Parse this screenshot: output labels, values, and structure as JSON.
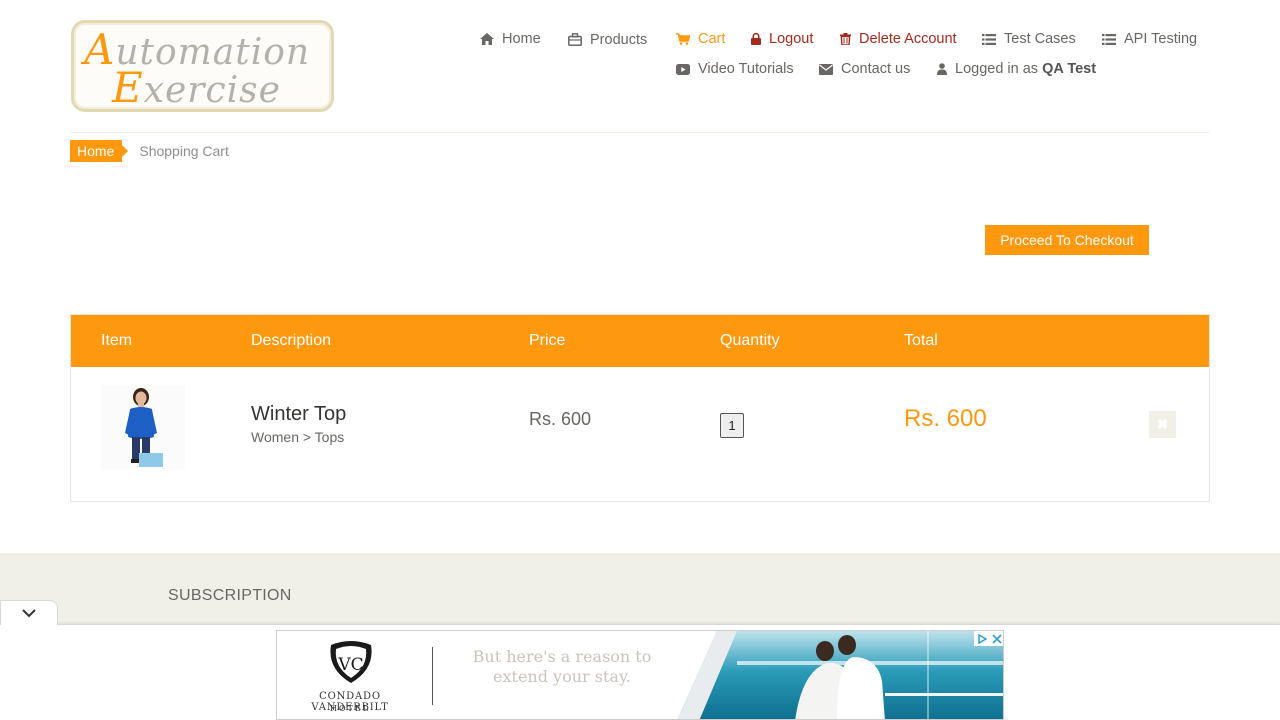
{
  "logo": {
    "line1_cap": "A",
    "line1_rest": "utomation",
    "line2_cap": "E",
    "line2_rest": "xercise"
  },
  "nav": {
    "home": "Home",
    "products": "Products",
    "cart": "Cart",
    "logout": "Logout",
    "delete_account": "Delete Account",
    "test_cases": "Test Cases",
    "api_testing": "API Testing",
    "video_tutorials": "Video Tutorials",
    "contact_us": "Contact us",
    "logged_in_prefix": "Logged in as",
    "logged_in_user": "QA Test"
  },
  "breadcrumb": {
    "home": "Home",
    "current": "Shopping Cart"
  },
  "checkout_button": "Proceed To Checkout",
  "cart": {
    "headers": {
      "item": "Item",
      "description": "Description",
      "price": "Price",
      "quantity": "Quantity",
      "total": "Total"
    },
    "rows": [
      {
        "name": "Winter Top",
        "category": "Women > Tops",
        "price": "Rs. 600",
        "quantity": "1",
        "total": "Rs. 600",
        "delete_icon": "close-icon"
      }
    ]
  },
  "footer": {
    "subscription_title": "SUBSCRIPTION"
  },
  "ad": {
    "brand_line1": "CONDADO VANDERBILT",
    "brand_line2": "HOTEL",
    "tagline": "But here's a reason to extend your stay."
  },
  "colors": {
    "accent": "#fe980f",
    "danger": "#a62a1c",
    "footer_bg": "#f0f0e9",
    "text": "#696763"
  }
}
